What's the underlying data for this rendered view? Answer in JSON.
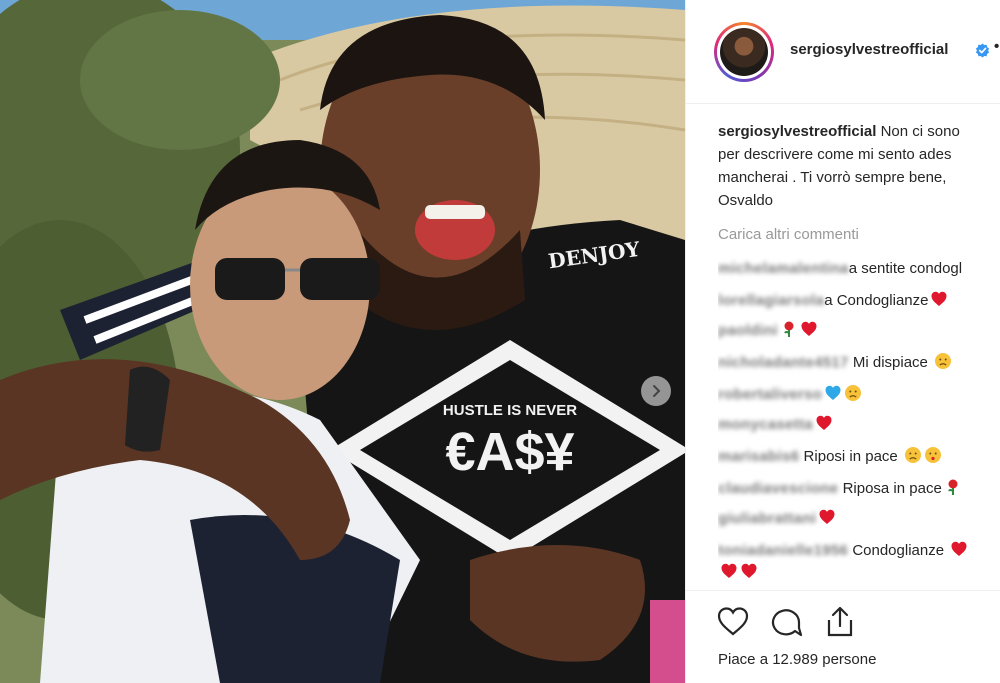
{
  "post": {
    "username": "sergiosylvestreofficial",
    "header_dot": "•",
    "caption": {
      "username": "sergiosylvestreofficial",
      "line1": "Non ci sono",
      "line2": "per descrivere come mi sento ades",
      "line3": "mancherai . Ti vorrò sempre bene, ",
      "line4": "Osvaldo"
    },
    "load_more_label": "Carica altri commenti",
    "comments": [
      {
        "user": "michelamalentina",
        "text": "a sentite condogl",
        "emoji": []
      },
      {
        "user": "lorellagiarsola",
        "text": "a Condoglianze",
        "emoji": [
          "heart"
        ]
      },
      {
        "user": "paoldini",
        "text": "",
        "emoji": [
          "rose",
          "heart"
        ]
      },
      {
        "user": "nicholadante4517",
        "text": " Mi dispiace ",
        "emoji": [
          "sad"
        ]
      },
      {
        "user": "robertaliverso",
        "text": "",
        "emoji": [
          "blue-heart",
          "sad"
        ]
      },
      {
        "user": "monycasetta",
        "text": "",
        "emoji": [
          "heart"
        ]
      },
      {
        "user": "marisabis6",
        "text": " Riposi in pace ",
        "emoji": [
          "sad",
          "kiss"
        ]
      },
      {
        "user": "claudiavescione",
        "text": " Riposa in pace",
        "emoji": [
          "rose"
        ]
      },
      {
        "user": "giuliabrattani",
        "text": "",
        "emoji": [
          "heart"
        ]
      },
      {
        "user": "toniadanielle1956",
        "text": " Condoglianze ",
        "emoji": [
          "heart"
        ]
      },
      {
        "user": "",
        "text": "",
        "emoji": [
          "heart",
          "heart"
        ]
      }
    ],
    "likes_text": "Piace a 12.989 persone",
    "icons": {
      "like": "heart-outline-icon",
      "comment": "comment-bubble-icon",
      "share": "share-upload-icon",
      "verified": "verified-badge-icon",
      "next": "carousel-next-icon"
    },
    "colors": {
      "verified": "#3897f0",
      "heart_red": "#ed4956",
      "muted": "#999999"
    }
  }
}
